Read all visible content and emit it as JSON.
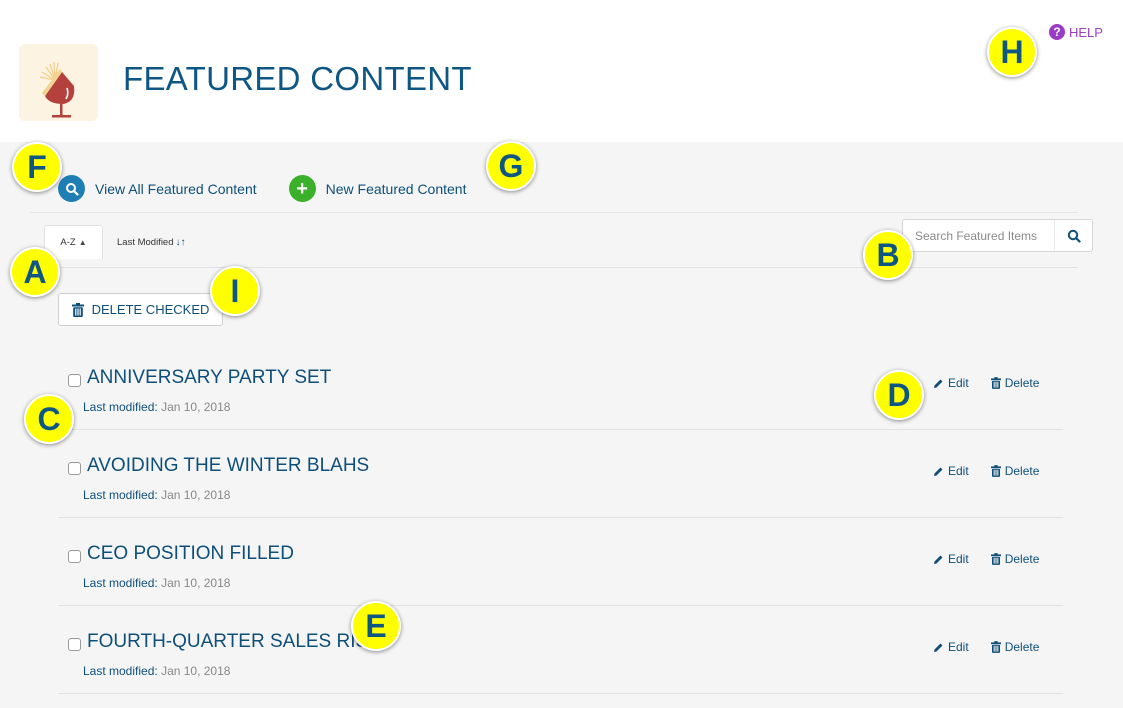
{
  "header": {
    "title": "FEATURED CONTENT",
    "logo_icon": "megaphone-icon",
    "help_label": "HELP",
    "help_icon": "question-circle-icon"
  },
  "toolbar": {
    "view_all_label": "View All Featured Content",
    "view_all_icon": "search-icon",
    "new_label": "New Featured Content",
    "new_icon": "plus-icon",
    "new_icon_glyph": "+"
  },
  "sort": {
    "tabs": [
      {
        "label": "A-Z",
        "indicator": "▲",
        "active": true
      },
      {
        "label": "Last Modified",
        "indicator": "↓↑",
        "active": false
      }
    ]
  },
  "search": {
    "placeholder": "Search Featured Items",
    "value": ""
  },
  "bulk": {
    "delete_checked_label": "DELETE CHECKED"
  },
  "items": [
    {
      "title": "ANNIVERSARY PARTY SET",
      "modified_label": "Last modified:",
      "modified": "Jan 10, 2018",
      "edit_label": "Edit",
      "delete_label": "Delete",
      "checked": false
    },
    {
      "title": "AVOIDING THE WINTER BLAHS",
      "modified_label": "Last modified:",
      "modified": "Jan 10, 2018",
      "edit_label": "Edit",
      "delete_label": "Delete",
      "checked": false
    },
    {
      "title": "CEO POSITION FILLED",
      "modified_label": "Last modified:",
      "modified": "Jan 10, 2018",
      "edit_label": "Edit",
      "delete_label": "Delete",
      "checked": false
    },
    {
      "title": "FOURTH-QUARTER SALES RISE",
      "modified_label": "Last modified:",
      "modified": "Jan 10, 2018",
      "edit_label": "Edit",
      "delete_label": "Delete",
      "checked": false
    }
  ],
  "annotations": {
    "A": "A",
    "B": "B",
    "C": "C",
    "D": "D",
    "E": "E",
    "F": "F",
    "G": "G",
    "H": "H",
    "I": "I"
  },
  "colors": {
    "title_blue": "#0e5784",
    "help_purple": "#9b3cc7",
    "view_icon_blue": "#1f7fb5",
    "new_icon_green": "#3bb02b",
    "annotation_yellow": "#ffff00",
    "background": "#f5f5f5"
  }
}
